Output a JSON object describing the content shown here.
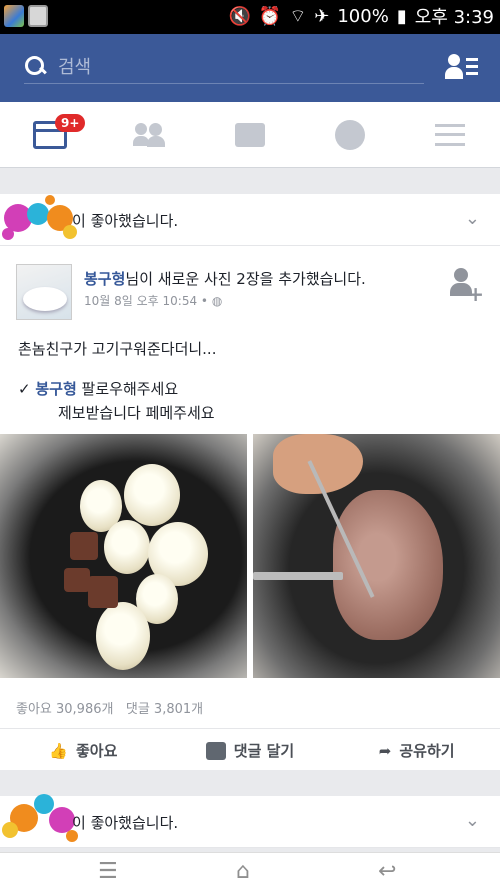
{
  "status_bar": {
    "battery": "100%",
    "time": "오후 3:39",
    "icons": [
      "app-icon",
      "app-icon",
      "silent-icon",
      "alarm-icon",
      "wifi-icon",
      "airplane-icon",
      "battery-icon"
    ]
  },
  "top_bar": {
    "search_placeholder": "검색",
    "accent": "#3b5998"
  },
  "nav_tabs": [
    {
      "name": "news-feed",
      "badge": "9+"
    },
    {
      "name": "friends"
    },
    {
      "name": "messages"
    },
    {
      "name": "notifications"
    },
    {
      "name": "menu"
    }
  ],
  "stories": {
    "first": {
      "text": "이 좋아했습니다."
    },
    "second": {
      "text": "이 좋아했습니다."
    }
  },
  "post": {
    "author": "봉구형",
    "action_text": "님이 새로운 사진 2장을 추가했습니다.",
    "date": "10월 8일 오후 10:54",
    "visibility_dot": "•",
    "body_line1": "촌놈친구가 고기구워준다더니...",
    "check": "✓",
    "mention": "봉구형",
    "body_line2": "팔로우해주세요",
    "body_line3": "제보받습니다 페메주세요",
    "like_count": "좋아요 30,986개",
    "comment_count": "댓글 3,801개",
    "actions": {
      "like": "좋아요",
      "comment": "댓글 달기",
      "share": "공유하기"
    }
  },
  "bottom_nav": {
    "menu_glyph": "☰",
    "home_glyph": "⌂",
    "back_glyph": "↩"
  }
}
